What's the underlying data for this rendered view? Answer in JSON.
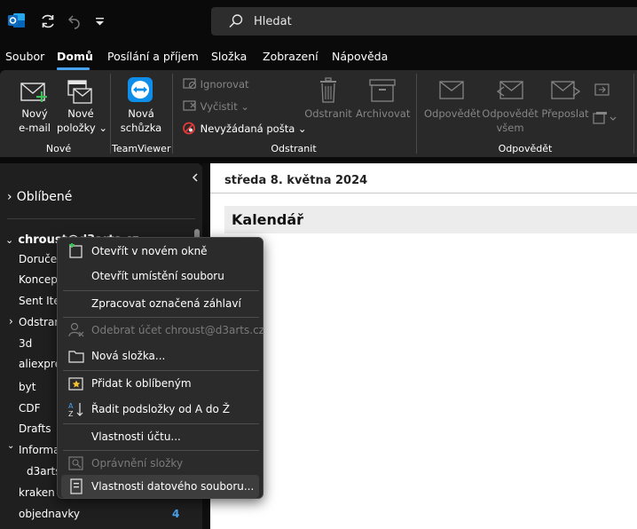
{
  "titlebar": {
    "search_placeholder": "Hledat"
  },
  "menu": {
    "tabs": [
      "Soubor",
      "Domů",
      "Posílání a příjem",
      "Složka",
      "Zobrazení",
      "Nápověda"
    ],
    "active_index": 1
  },
  "ribbon": {
    "new_email": [
      "Nový",
      "e-mail"
    ],
    "new_items": [
      "Nové",
      "položky"
    ],
    "new_meeting": [
      "Nová",
      "schůzka"
    ],
    "group_new": "Nové",
    "group_teamviewer": "TeamViewer",
    "ignore": "Ignorovat",
    "clean": "Vyčistit",
    "junk": "Nevyžádaná pošta",
    "delete": "Odstranit",
    "archive": "Archivovat",
    "group_delete": "Odstranit",
    "reply": "Odpovědět",
    "reply_all": [
      "Odpovědět",
      "všem"
    ],
    "forward": "Přeposlat",
    "group_reply": "Odpovědět"
  },
  "nav": {
    "favorites": "Oblíbené",
    "account": "chroust@d3arts.cz",
    "folders": [
      "Doručená pošta",
      "Koncepty",
      "Sent Items",
      "Odstraněná pošta",
      "3d",
      "aliexpress",
      "byt",
      "CDF",
      "Drafts",
      "Informace",
      "d3arts",
      "kraken",
      "objednavky"
    ],
    "objednavky_count": "4"
  },
  "main": {
    "date": "středa 8. května 2024",
    "calendar_title": "Kalendář"
  },
  "context_menu": {
    "items": [
      "Otevřít v novém okně",
      "Otevřít umístění souboru",
      "Zpracovat označená záhlaví",
      "Odebrat účet chroust@d3arts.cz",
      "Nová složka...",
      "Přidat k oblíbeným",
      "Řadit podsložky od A do Ž",
      "Vlastnosti účtu...",
      "Oprávnění složky",
      "Vlastnosti datového souboru..."
    ]
  },
  "colors": {
    "accent": "#4aa3f0",
    "outlook_blue": "#0f6cbd",
    "teamviewer_blue": "#0e8ee9",
    "junk_red": "#e03a3a"
  }
}
